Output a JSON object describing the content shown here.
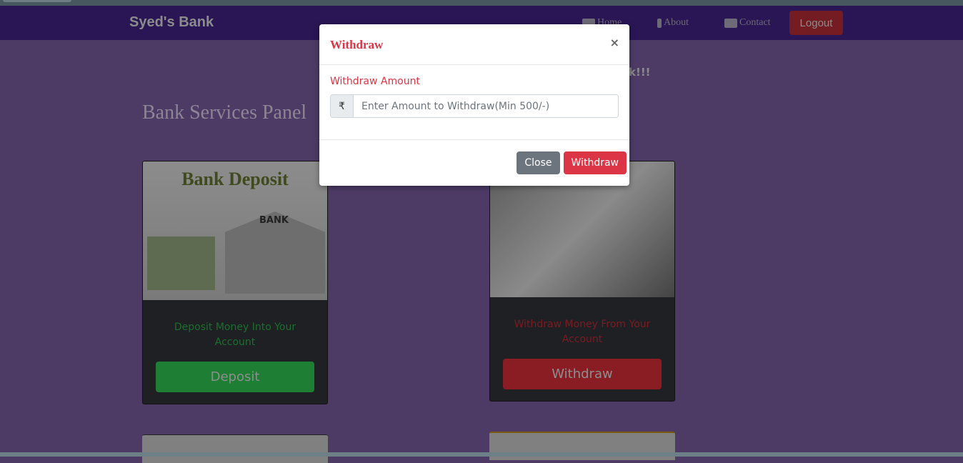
{
  "navbar": {
    "brand": "Syed's Bank",
    "links": [
      {
        "label": "Home",
        "icon": "home-icon"
      },
      {
        "label": "About",
        "icon": "info-icon"
      },
      {
        "label": "Contact",
        "icon": "contact-card-icon"
      }
    ],
    "logout": "Logout"
  },
  "welcome_fragment": "k!!!",
  "panel_title": "Bank Services Panel",
  "cards": [
    {
      "image_text": "Bank Deposit",
      "image_bank": "BANK",
      "text": "Deposit Money Into Your Account",
      "button": "Deposit",
      "color": "#1e7e34"
    },
    {
      "text": "Withdraw Money From Your Account",
      "button": "Withdraw",
      "color": "#9b1c25"
    }
  ],
  "modal": {
    "title": "Withdraw",
    "close_symbol": "×",
    "label": "Withdraw Amount",
    "currency": "₹",
    "placeholder": "Enter Amount to Withdraw(Min 500/-)",
    "close_button": "Close",
    "submit_button": "Withdraw"
  }
}
